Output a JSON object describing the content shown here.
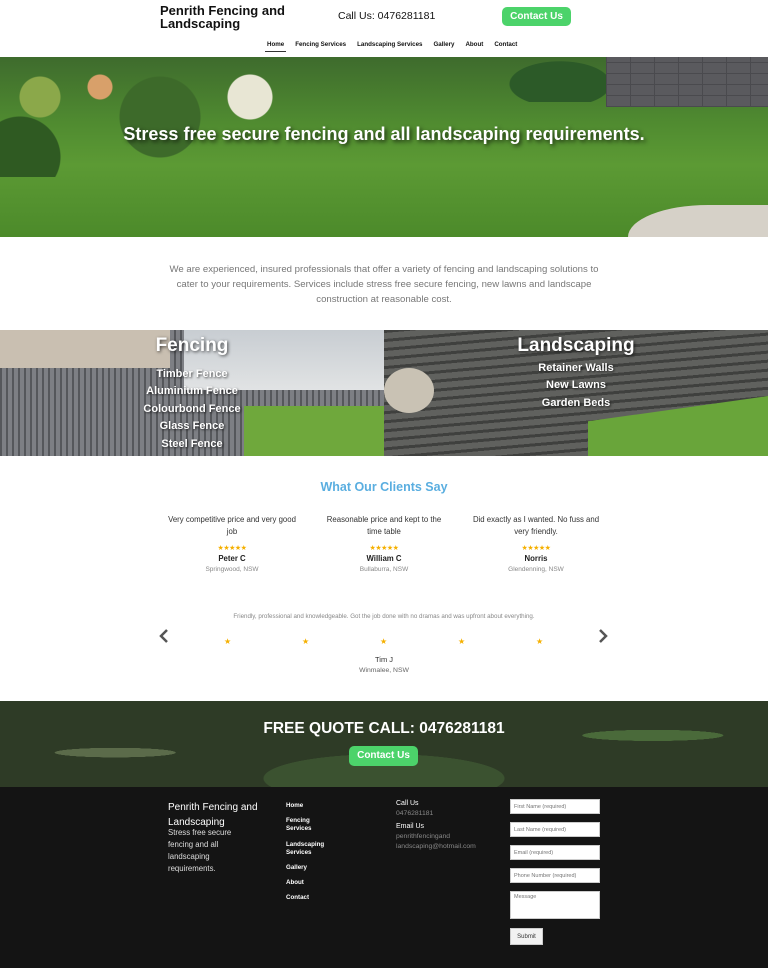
{
  "header": {
    "logo": "Penrith Fencing and Landscaping",
    "call": "Call Us: 0476281181",
    "contact_button": "Contact Us"
  },
  "nav": [
    "Home",
    "Fencing Services",
    "Landscaping Services",
    "Gallery",
    "About",
    "Contact"
  ],
  "hero": {
    "title": "Stress free secure fencing and all landscaping requirements."
  },
  "intro": "We are experienced, insured professionals that offer a variety of fencing and landscaping solutions to cater to your requirements. Services include stress free secure fencing, new lawns and landscape construction at reasonable cost.",
  "fencing": {
    "title": "Fencing",
    "items": [
      "Timber Fence",
      "Aluminium Fence",
      "Colourbond Fence",
      "Glass Fence",
      "Steel Fence"
    ]
  },
  "landscaping": {
    "title": "Landscaping",
    "items": [
      "Retainer Walls",
      "New Lawns",
      "Garden Beds"
    ]
  },
  "testimonials": {
    "title": "What Our Clients Say",
    "items": [
      {
        "quote": "Very competitive price and very good job",
        "stars": "★★★★★",
        "name": "Peter C",
        "location": "Springwood, NSW"
      },
      {
        "quote": "Reasonable price and kept to the time table",
        "stars": "★★★★★",
        "name": "William C",
        "location": "Bullaburra, NSW"
      },
      {
        "quote": "Did exactly as I wanted. No fuss and very friendly.",
        "stars": "★★★★★",
        "name": "Norris",
        "location": "Glendenning, NSW"
      }
    ],
    "carousel": {
      "quote": "Friendly, professional and knowledgeable. Got the job done with no dramas and was upfront about everything.",
      "star": "★",
      "rating": 5,
      "name": "Tim J",
      "location": "Winmalee, NSW",
      "prev_icon": "chevron-left-icon",
      "next_icon": "chevron-right-icon"
    }
  },
  "quote_band": {
    "title": "FREE QUOTE CALL: 0476281181",
    "button": "Contact Us"
  },
  "footer": {
    "brand": "Penrith Fencing and Landscaping",
    "tagline": "Stress free secure fencing and all landscaping requirements.",
    "links": [
      "Home",
      "Fencing Services",
      "Landscaping Services",
      "Gallery",
      "About",
      "Contact"
    ],
    "call_label": "Call Us",
    "call_value": "0476281181",
    "email_label": "Email Us",
    "email_value": "penrithfencingand landscaping@hotmail.com",
    "form": {
      "first_name": "First Name (required)",
      "last_name": "Last Name (required)",
      "email": "Email (required)",
      "phone": "Phone Number (required)",
      "message": "Message",
      "submit": "Submit"
    }
  },
  "colors": {
    "accent_green": "#4cd36a",
    "heading_blue": "#5aaee0",
    "star_gold": "#f5b000",
    "footer_bg": "#141414"
  }
}
